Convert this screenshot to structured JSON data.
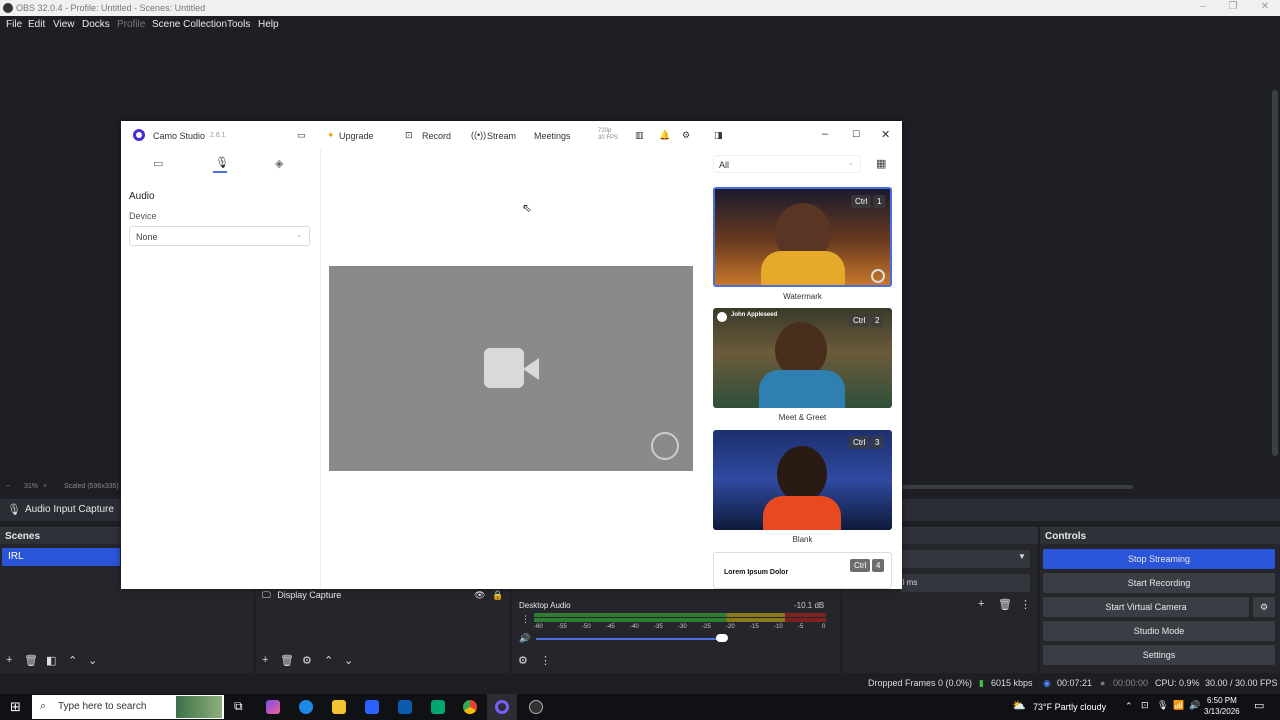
{
  "obs": {
    "title": "OBS 32.0.4 - Profile: Untitled - Scenes: Untitled",
    "menu": [
      "File",
      "Edit",
      "View",
      "Docks",
      "Profile",
      "Scene Collection",
      "Tools",
      "Help"
    ],
    "status_strip": {
      "zoom": "31%",
      "scaled": "Scaled (596x335)"
    },
    "source_bar_label": "Audio Input Capture",
    "scenes": {
      "title": "Scenes",
      "items": [
        "IRL"
      ]
    },
    "sources": {
      "items": [
        "Display Capture"
      ]
    },
    "audio_mixer": {
      "channel": "Desktop Audio",
      "level": "-10.1 dB",
      "ticks": [
        "-60",
        "-55",
        "-50",
        "-45",
        "-40",
        "-35",
        "-30",
        "-25",
        "-20",
        "-15",
        "-10",
        "-5",
        "0"
      ]
    },
    "transitions": {
      "title": "tions",
      "duration": "0 ms"
    },
    "controls": {
      "title": "Controls",
      "buttons": [
        "Stop Streaming",
        "Start Recording",
        "Start Virtual Camera",
        "Studio Mode",
        "Settings"
      ]
    },
    "statusbar": {
      "dropped": "Dropped Frames 0 (0.0%)",
      "bitrate": "6015 kbps",
      "stream_time": "00:07:21",
      "rec_time": "00:00:00",
      "cpu": "CPU: 0.9%",
      "fps": "30.00 / 30.00 FPS"
    }
  },
  "camo": {
    "app_name": "Camo Studio",
    "version": "2.6.1",
    "upgrade": "Upgrade",
    "record": "Record",
    "stream": "Stream",
    "meetings": "Meetings",
    "resolution": "720p",
    "fps": "30 FPS",
    "audio_title": "Audio",
    "device_label": "Device",
    "device_value": "None",
    "filter_value": "All",
    "scenes": [
      {
        "label": "Watermark",
        "shortcut_mod": "Ctrl",
        "shortcut_key": "1"
      },
      {
        "label": "Meet & Greet",
        "shortcut_mod": "Ctrl",
        "shortcut_key": "2",
        "overlay_name": "John Appleseed"
      },
      {
        "label": "Blank",
        "shortcut_mod": "Ctrl",
        "shortcut_key": "3"
      },
      {
        "label": "",
        "shortcut_mod": "Ctrl",
        "shortcut_key": "4",
        "overlay_text": "Lorem Ipsum Dolor"
      }
    ],
    "accent": "#4a2bd6"
  },
  "taskbar": {
    "search_placeholder": "Type here to search",
    "weather": "73°F  Partly cloudy",
    "time": "6:50 PM",
    "date": "3/13/2026"
  }
}
